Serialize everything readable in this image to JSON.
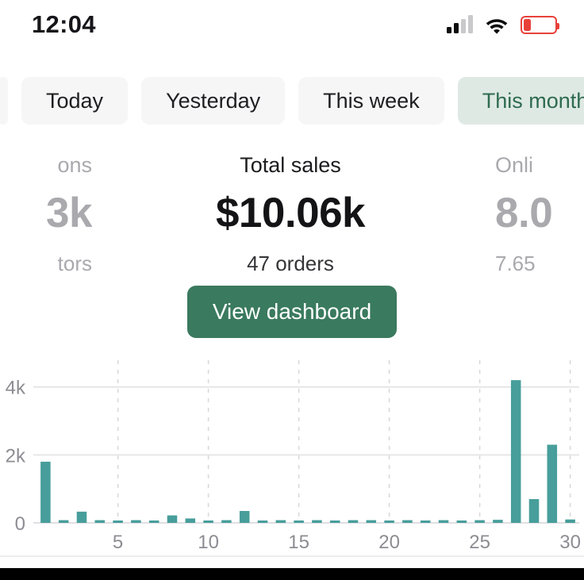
{
  "statusbar": {
    "time": "12:04",
    "signal_icon": "cellular-signal-icon",
    "wifi_icon": "wifi-icon",
    "battery_icon": "battery-low-icon",
    "battery_level_pct": 24
  },
  "filters": {
    "chips": [
      {
        "label": "",
        "selected": false,
        "partial": true
      },
      {
        "label": "Today",
        "selected": false,
        "partial": false
      },
      {
        "label": "Yesterday",
        "selected": false,
        "partial": false
      },
      {
        "label": "This week",
        "selected": false,
        "partial": false
      },
      {
        "label": "This month",
        "selected": true,
        "partial": false
      }
    ],
    "selected_chip": "This month"
  },
  "metrics": [
    {
      "title": "ons",
      "value": "3k",
      "sub": "tors",
      "clipped": true
    },
    {
      "title": "Total sales",
      "value": "$10.06k",
      "sub": "47 orders",
      "clipped": false
    },
    {
      "title": "Onli",
      "value": "8.0",
      "sub": "7.65",
      "clipped": true
    }
  ],
  "cta": {
    "label": "View dashboard"
  },
  "colors": {
    "accent_green": "#3a7a5e",
    "chip_selected_bg": "#dfe9e4",
    "chip_selected_text": "#2e6b4f",
    "chip_bg": "#f6f6f7",
    "bar_teal": "#479e9b",
    "grid_line": "#e6e6e8",
    "axis_text": "#8c8c93",
    "battery_red": "#e8413a"
  },
  "chart_data": {
    "type": "bar",
    "title": "",
    "xlabel": "",
    "ylabel": "",
    "grid": true,
    "legend": null,
    "ylim": [
      0,
      4600
    ],
    "ytick_values": [
      0,
      2000,
      4000
    ],
    "ytick_labels": [
      "0",
      "2k",
      "4k"
    ],
    "xtick_values": [
      5,
      10,
      15,
      20,
      25,
      30
    ],
    "xtick_labels": [
      "5",
      "10",
      "15",
      "20",
      "25",
      "30"
    ],
    "categories": [
      1,
      2,
      3,
      4,
      5,
      6,
      7,
      8,
      9,
      10,
      11,
      12,
      13,
      14,
      15,
      16,
      17,
      18,
      19,
      20,
      21,
      22,
      23,
      24,
      25,
      26,
      27,
      28,
      29,
      30
    ],
    "values": [
      1800,
      80,
      330,
      80,
      70,
      80,
      70,
      220,
      130,
      70,
      80,
      350,
      70,
      80,
      70,
      80,
      70,
      80,
      80,
      70,
      80,
      70,
      80,
      70,
      80,
      90,
      4200,
      700,
      2300,
      100
    ]
  }
}
